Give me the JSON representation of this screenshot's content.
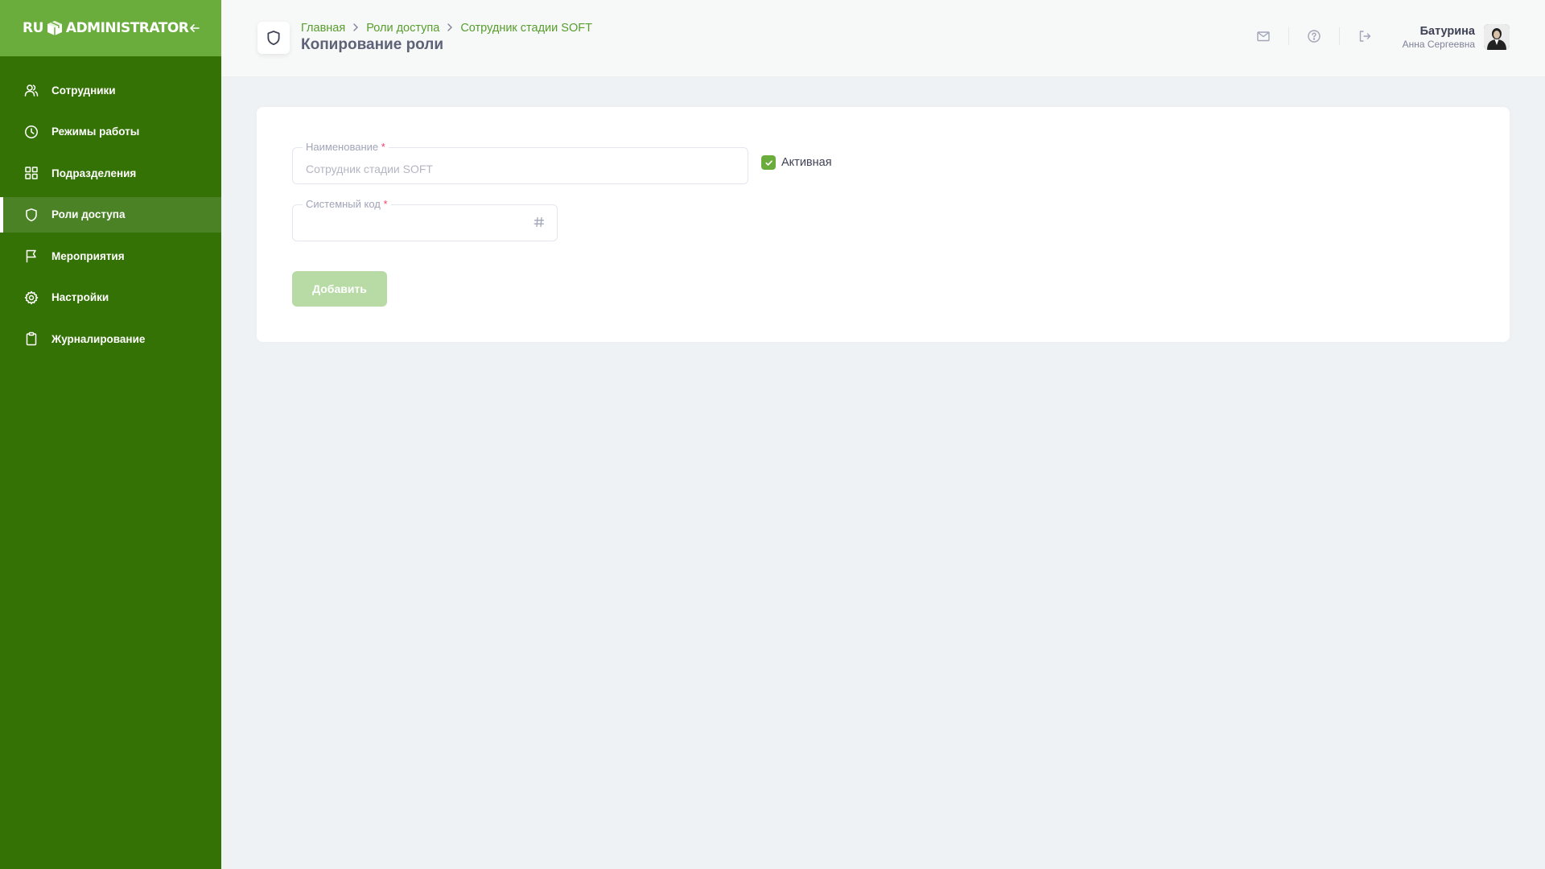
{
  "brand": {
    "logo_left": "RU",
    "logo_right": "ADMINISTRATOR",
    "accent": "#6aad3d",
    "sidebar_bg": "#357205"
  },
  "sidebar": {
    "items": [
      {
        "label": "Сотрудники",
        "icon": "users-icon",
        "active": false
      },
      {
        "label": "Режимы работы",
        "icon": "clock-icon",
        "active": false
      },
      {
        "label": "Подразделения",
        "icon": "grid-icon",
        "active": false
      },
      {
        "label": "Роли доступа",
        "icon": "shield-icon",
        "active": true
      },
      {
        "label": "Мероприятия",
        "icon": "flag-icon",
        "active": false
      },
      {
        "label": "Настройки",
        "icon": "gear-icon",
        "active": false
      },
      {
        "label": "Журналирование",
        "icon": "clipboard-icon",
        "active": false
      }
    ]
  },
  "header": {
    "breadcrumb": [
      "Главная",
      "Роли доступа",
      "Сотрудник стадии SOFT"
    ],
    "title": "Копирование роли",
    "user": {
      "last_name": "Батурина",
      "first_name": "Анна Сергеевна"
    }
  },
  "form": {
    "name_label": "Наименование",
    "name_placeholder": "Сотрудник стадии SOFT",
    "name_value": "",
    "active_label": "Активная",
    "active_checked": true,
    "code_label": "Системный код",
    "code_value": "",
    "required_mark": "*",
    "submit_label": "Добавить"
  }
}
